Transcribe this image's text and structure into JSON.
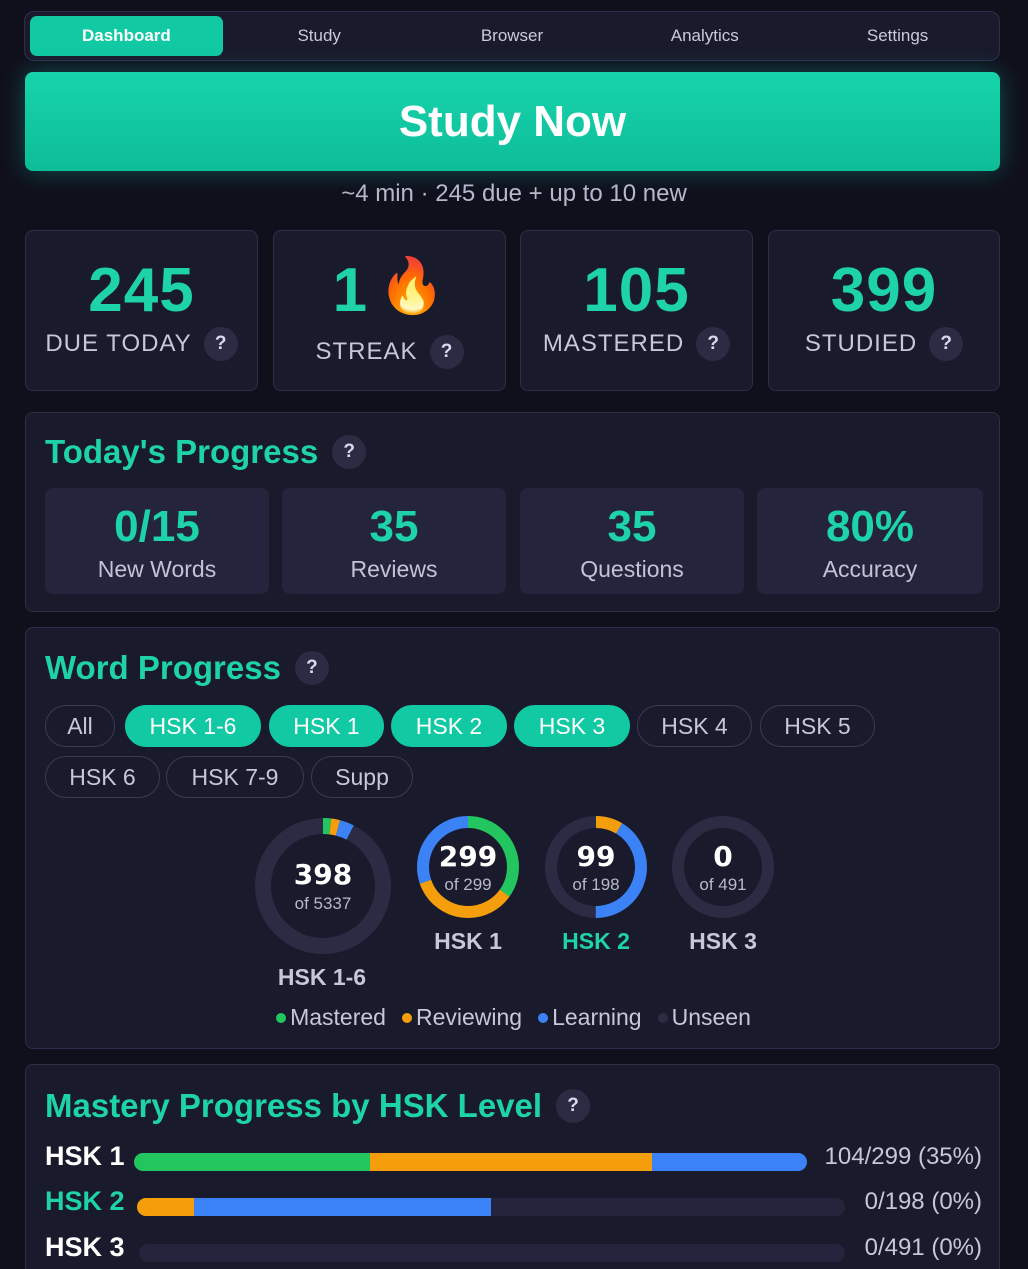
{
  "nav": {
    "tabs": [
      {
        "label": "Dashboard",
        "active": true
      },
      {
        "label": "Study",
        "active": false
      },
      {
        "label": "Browser",
        "active": false
      },
      {
        "label": "Analytics",
        "active": false
      },
      {
        "label": "Settings",
        "active": false
      }
    ]
  },
  "study": {
    "button_label": "Study Now",
    "summary": "~4 min · 245 due + up to 10 new"
  },
  "stats": {
    "due_today": {
      "value": "245",
      "label": "DUE TODAY"
    },
    "streak": {
      "value": "1",
      "label": "STREAK",
      "icon": "fire-icon"
    },
    "mastered": {
      "value": "105",
      "label": "MASTERED"
    },
    "studied": {
      "value": "399",
      "label": "STUDIED"
    }
  },
  "help_glyph": "?",
  "today": {
    "title": "Today's Progress",
    "items": [
      {
        "value": "0/15",
        "label": "New Words"
      },
      {
        "value": "35",
        "label": "Reviews"
      },
      {
        "value": "35",
        "label": "Questions"
      },
      {
        "value": "80%",
        "label": "Accuracy"
      }
    ]
  },
  "word_progress": {
    "title": "Word Progress",
    "filters": [
      {
        "label": "All",
        "on": false
      },
      {
        "label": "HSK 1-6",
        "on": true
      },
      {
        "label": "HSK 1",
        "on": true
      },
      {
        "label": "HSK 2",
        "on": true
      },
      {
        "label": "HSK 3",
        "on": true
      },
      {
        "label": "HSK 4",
        "on": false
      },
      {
        "label": "HSK 5",
        "on": false
      },
      {
        "label": "HSK 6",
        "on": false
      },
      {
        "label": "HSK 7-9",
        "on": false
      },
      {
        "label": "Supp",
        "on": false
      }
    ],
    "rings": [
      {
        "label": "HSK 1-6",
        "value": "398",
        "of": "of 5337",
        "total": 5337,
        "mastered": 104,
        "reviewing": 110,
        "learning": 184,
        "highlight": false
      },
      {
        "label": "HSK 1",
        "value": "299",
        "of": "of 299",
        "total": 299,
        "mastered": 104,
        "reviewing": 104,
        "learning": 91,
        "highlight": false
      },
      {
        "label": "HSK 2",
        "value": "99",
        "of": "of 198",
        "total": 198,
        "mastered": 0,
        "reviewing": 17,
        "learning": 82,
        "highlight": true
      },
      {
        "label": "HSK 3",
        "value": "0",
        "of": "of 491",
        "total": 491,
        "mastered": 0,
        "reviewing": 0,
        "learning": 0,
        "highlight": false
      }
    ],
    "legend": [
      {
        "label": "Mastered",
        "color": "#22c55e"
      },
      {
        "label": "Reviewing",
        "color": "#f59e0b"
      },
      {
        "label": "Learning",
        "color": "#3b82f6"
      },
      {
        "label": "Unseen",
        "color": "#2b2c44"
      }
    ]
  },
  "mastery": {
    "title": "Mastery Progress by HSK Level",
    "rows": [
      {
        "level": "HSK 1",
        "summary": "104/299 (35%)",
        "mastered": 0.35,
        "reviewing": 0.42,
        "learning": 0.23,
        "highlight": false
      },
      {
        "level": "HSK 2",
        "summary": "0/198 (0%)",
        "mastered": 0,
        "reviewing": 0.08,
        "learning": 0.42,
        "highlight": true
      },
      {
        "level": "HSK 3",
        "summary": "0/491 (0%)",
        "mastered": 0,
        "reviewing": 0,
        "learning": 0,
        "highlight": false
      }
    ]
  },
  "colors": {
    "accent": "#1ed3a9",
    "mastered": "#22c55e",
    "reviewing": "#f59e0b",
    "learning": "#3b82f6",
    "track": "#2b2c44"
  }
}
